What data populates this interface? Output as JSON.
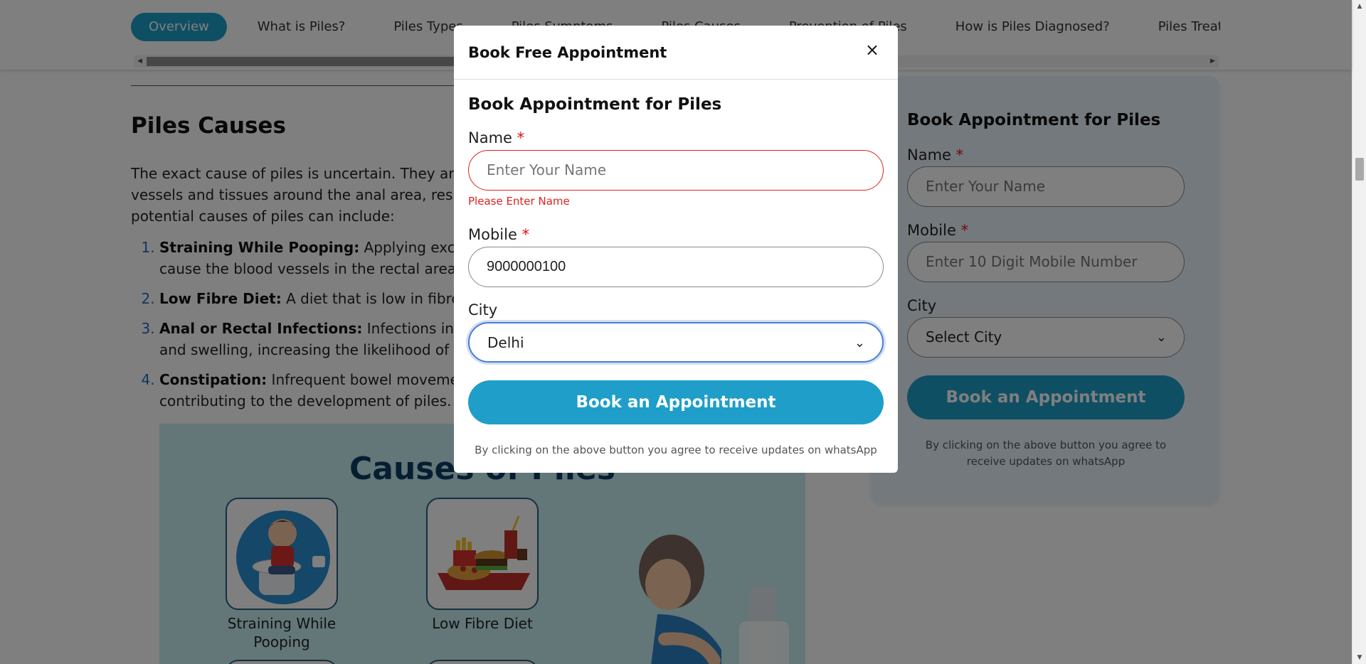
{
  "tabs": [
    {
      "label": "Overview",
      "active": true
    },
    {
      "label": "What is Piles?"
    },
    {
      "label": "Piles Types"
    },
    {
      "label": "Piles Symptoms"
    },
    {
      "label": "Piles Causes"
    },
    {
      "label": "Prevention of Piles"
    },
    {
      "label": "How is Piles Diagnosed?"
    },
    {
      "label": "Piles Treatment"
    }
  ],
  "article": {
    "heading": "Piles Causes",
    "intro": "The exact cause of piles is uncertain. They are associated with increased pressure on the blood vessels and tissues around the anal area, resulting in swelling and inflammation. Some of the potential causes of piles can include:",
    "causes": [
      {
        "title": "Straining While Pooping:",
        "text": " Applying excessive pressure during bowel movements can cause the blood vessels in the rectal area to swell, developing piles."
      },
      {
        "title": "Low Fibre Diet:",
        "text": " A diet that is low in fibre can lead to constipation and straining."
      },
      {
        "title": "Anal or Rectal Infections:",
        "text": " Infections in the anal or rectal area can cause inflammation and swelling, increasing the likelihood of developing piles."
      },
      {
        "title": "Constipation:",
        "text": " Infrequent bowel movements and hard stools increase straining, contributing to the development of piles."
      }
    ]
  },
  "infographic": {
    "title": "Causes of Piles",
    "items": [
      "Straining While Pooping",
      "Low Fibre Diet"
    ]
  },
  "sidebar": {
    "heading": "Book Appointment for Piles",
    "name_label": "Name",
    "name_placeholder": "Enter Your Name",
    "mobile_label": "Mobile",
    "mobile_placeholder": "Enter 10 Digit Mobile Number",
    "city_label": "City",
    "city_value": "Select City",
    "button": "Book an Appointment",
    "disclaimer": "By clicking on the above button you agree to receive updates on whatsApp"
  },
  "modal": {
    "title": "Book Free Appointment",
    "close": "×",
    "heading": "Book Appointment for Piles",
    "name_label": "Name",
    "name_placeholder": "Enter Your Name",
    "name_error": "Please Enter Name",
    "mobile_label": "Mobile",
    "mobile_value": "9000000100",
    "city_label": "City",
    "city_value": "Delhi",
    "button": "Book an Appointment",
    "disclaimer": "By clicking on the above button you agree to receive updates on whatsApp"
  },
  "required_mark": "*",
  "colors": {
    "accent": "#1e9ec9",
    "error": "#d22222",
    "focus": "#4a7fd4"
  }
}
